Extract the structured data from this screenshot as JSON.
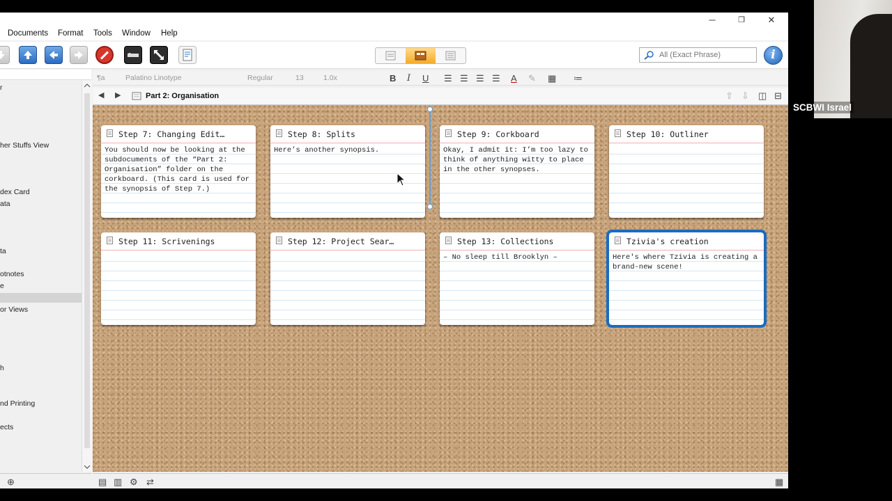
{
  "menu": {
    "items": [
      "Documents",
      "Format",
      "Tools",
      "Window",
      "Help"
    ]
  },
  "window_controls": {
    "minimize": "─",
    "restore": "❐",
    "close": "✕"
  },
  "search": {
    "placeholder": "All (Exact Phrase)"
  },
  "info_label": "i",
  "format_bar": {
    "style": "¶a",
    "font": "Palatino Linotype",
    "weight": "Regular",
    "size": "13",
    "spacing": "1.0x"
  },
  "binder": {
    "items": [
      {
        "label": "r"
      },
      {
        "label": "her Stuffs View"
      },
      {
        "label": "dex Card"
      },
      {
        "label": "ata"
      },
      {
        "label": "ta"
      },
      {
        "label": "otnotes"
      },
      {
        "label": "e"
      },
      {
        "label": "or Views"
      },
      {
        "label": "h"
      },
      {
        "label": "nd Printing"
      },
      {
        "label": "ects"
      }
    ]
  },
  "editor_header": {
    "title": "Part 2: Organisation"
  },
  "corkboard": {
    "cards": [
      {
        "title": "Step 7: Changing Edit…",
        "synopsis": "You should now be looking at the subdocuments of the “Part 2: Organisation” folder on the corkboard. (This card is used for the synopsis of Step 7.)",
        "selected": false
      },
      {
        "title": "Step 8: Splits",
        "synopsis": "Here’s another synopsis.",
        "selected": false
      },
      {
        "title": "Step 9: Corkboard",
        "synopsis": "Okay, I admit it: I’m too lazy to think of anything witty to place in the other synopses.",
        "selected": false
      },
      {
        "title": "Step 10: Outliner",
        "synopsis": "",
        "selected": false
      },
      {
        "title": "Step 11: Scrivenings",
        "synopsis": "",
        "selected": false
      },
      {
        "title": "Step 12: Project Sear…",
        "synopsis": "",
        "selected": false
      },
      {
        "title": "Step 13: Collections",
        "synopsis": "– No sleep till Brooklyn –",
        "selected": false
      },
      {
        "title": "Tzivia's creation",
        "synopsis": "Here's where Tzivia is creating a brand-new scene!",
        "selected": true
      }
    ]
  },
  "webcam": {
    "label": "SCBWI Israel"
  },
  "colors": {
    "cork": "#c7a37b",
    "selection": "#1a6bc2",
    "view_active": "#f4ac2a"
  }
}
